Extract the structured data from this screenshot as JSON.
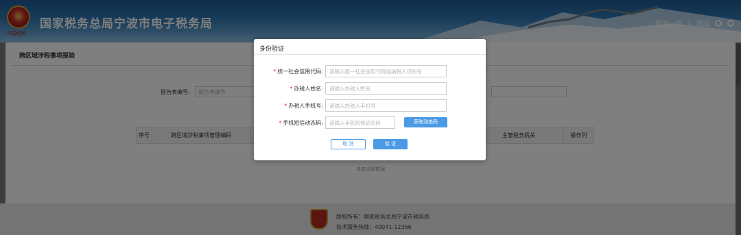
{
  "header": {
    "emblem_text": "中国税务",
    "title": "国家税务总局宁波市电子税务局",
    "welcome": "欢迎，您",
    "separator": "|",
    "logout": "退出",
    "icons": [
      "settings-icon",
      "search-icon"
    ]
  },
  "page": {
    "title": "跨区域涉税事项报验",
    "report_label": "报告表编号:",
    "report_placeholder": "报告表编号"
  },
  "table": {
    "columns": [
      "序号",
      "跨区域涉税事项管理编码",
      "",
      "",
      "",
      "主管税务机关",
      "操作列"
    ],
    "empty_text": "未查询到数据"
  },
  "dialog": {
    "title": "身份验证",
    "fields": [
      {
        "label": "统一社会信用代码:",
        "required": "*",
        "placeholder": "请输入统一社会信用代码或纳税人识别号",
        "value": ""
      },
      {
        "label": "办税人姓名:",
        "required": "*",
        "placeholder": "请输入办税人姓名",
        "value": ""
      },
      {
        "label": "办税人手机号:",
        "required": "*",
        "placeholder": "请输入办税人手机号",
        "value": ""
      },
      {
        "label": "手机短信动态码:",
        "required": "*",
        "placeholder": "请输入手机短信动态码",
        "value": ""
      }
    ],
    "get_code_button": "获取动态码",
    "cancel_button": "取 消",
    "confirm_button": "验 证"
  },
  "footer": {
    "copyright": "版权所有：国家税务总局宁波市税务局",
    "hotline": "技术服务热线：40071-12366"
  },
  "colors": {
    "primary": "#4a9ae6",
    "header": "#2f78b3",
    "required": "#e02020"
  }
}
